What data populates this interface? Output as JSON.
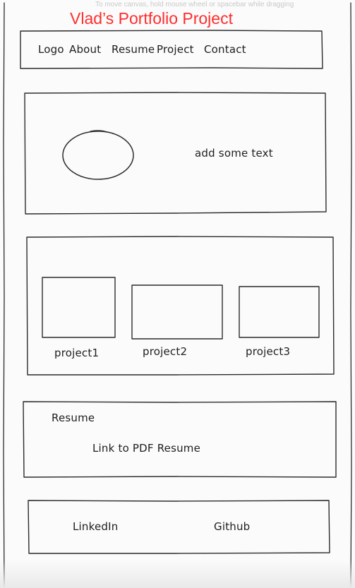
{
  "canvas_hint": "To move canvas, hold mouse wheel or spacebar while dragging",
  "title": "Vlad’s Portfolio Project",
  "title_color": "#ff2d2d",
  "nav": {
    "items": [
      "Logo",
      "About",
      "Resume",
      "Project",
      "Contact"
    ]
  },
  "hero": {
    "text": "add some text",
    "image_shape": "circle"
  },
  "projects": {
    "items": [
      "project1",
      "project2",
      "project3"
    ]
  },
  "resume": {
    "heading": "Resume",
    "link": "Link to PDF Resume"
  },
  "footer": {
    "links": [
      "LinkedIn",
      "Github"
    ]
  }
}
